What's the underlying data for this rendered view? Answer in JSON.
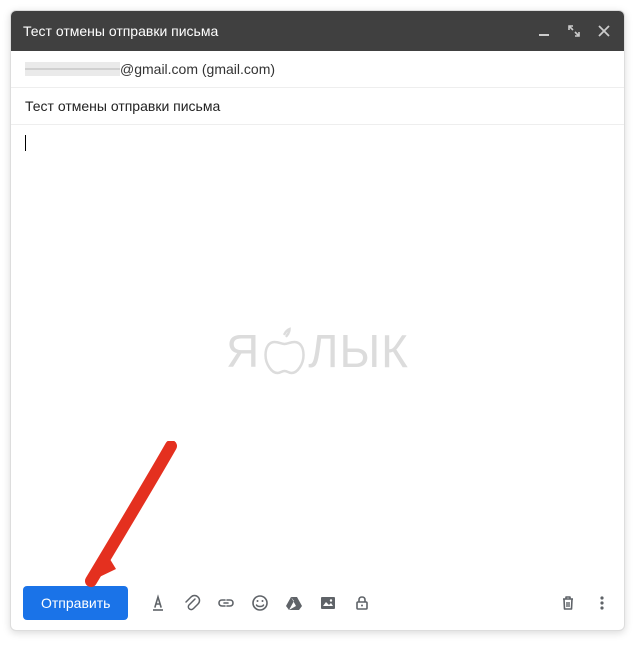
{
  "window": {
    "title": "Тест отмены отправки письма"
  },
  "recipient": {
    "suffix": "@gmail.com (gmail.com)"
  },
  "subject": {
    "value": "Тест отмены отправки письма"
  },
  "body": {
    "value": ""
  },
  "watermark": {
    "left": "Я",
    "right": "ЛЫК"
  },
  "toolbar": {
    "send_label": "Отправить"
  },
  "icons": {
    "minimize": "minimize",
    "expand": "expand",
    "close": "close",
    "format": "format-text",
    "attach": "attach-file",
    "link": "insert-link",
    "emoji": "insert-emoji",
    "drive": "google-drive",
    "image": "insert-image",
    "confidential": "confidential-mode",
    "trash": "discard-draft",
    "more": "more-options"
  },
  "colors": {
    "accent": "#1a73e8",
    "titlebar": "#404040",
    "icon": "#5f6368",
    "annotation": "#e4301f"
  }
}
